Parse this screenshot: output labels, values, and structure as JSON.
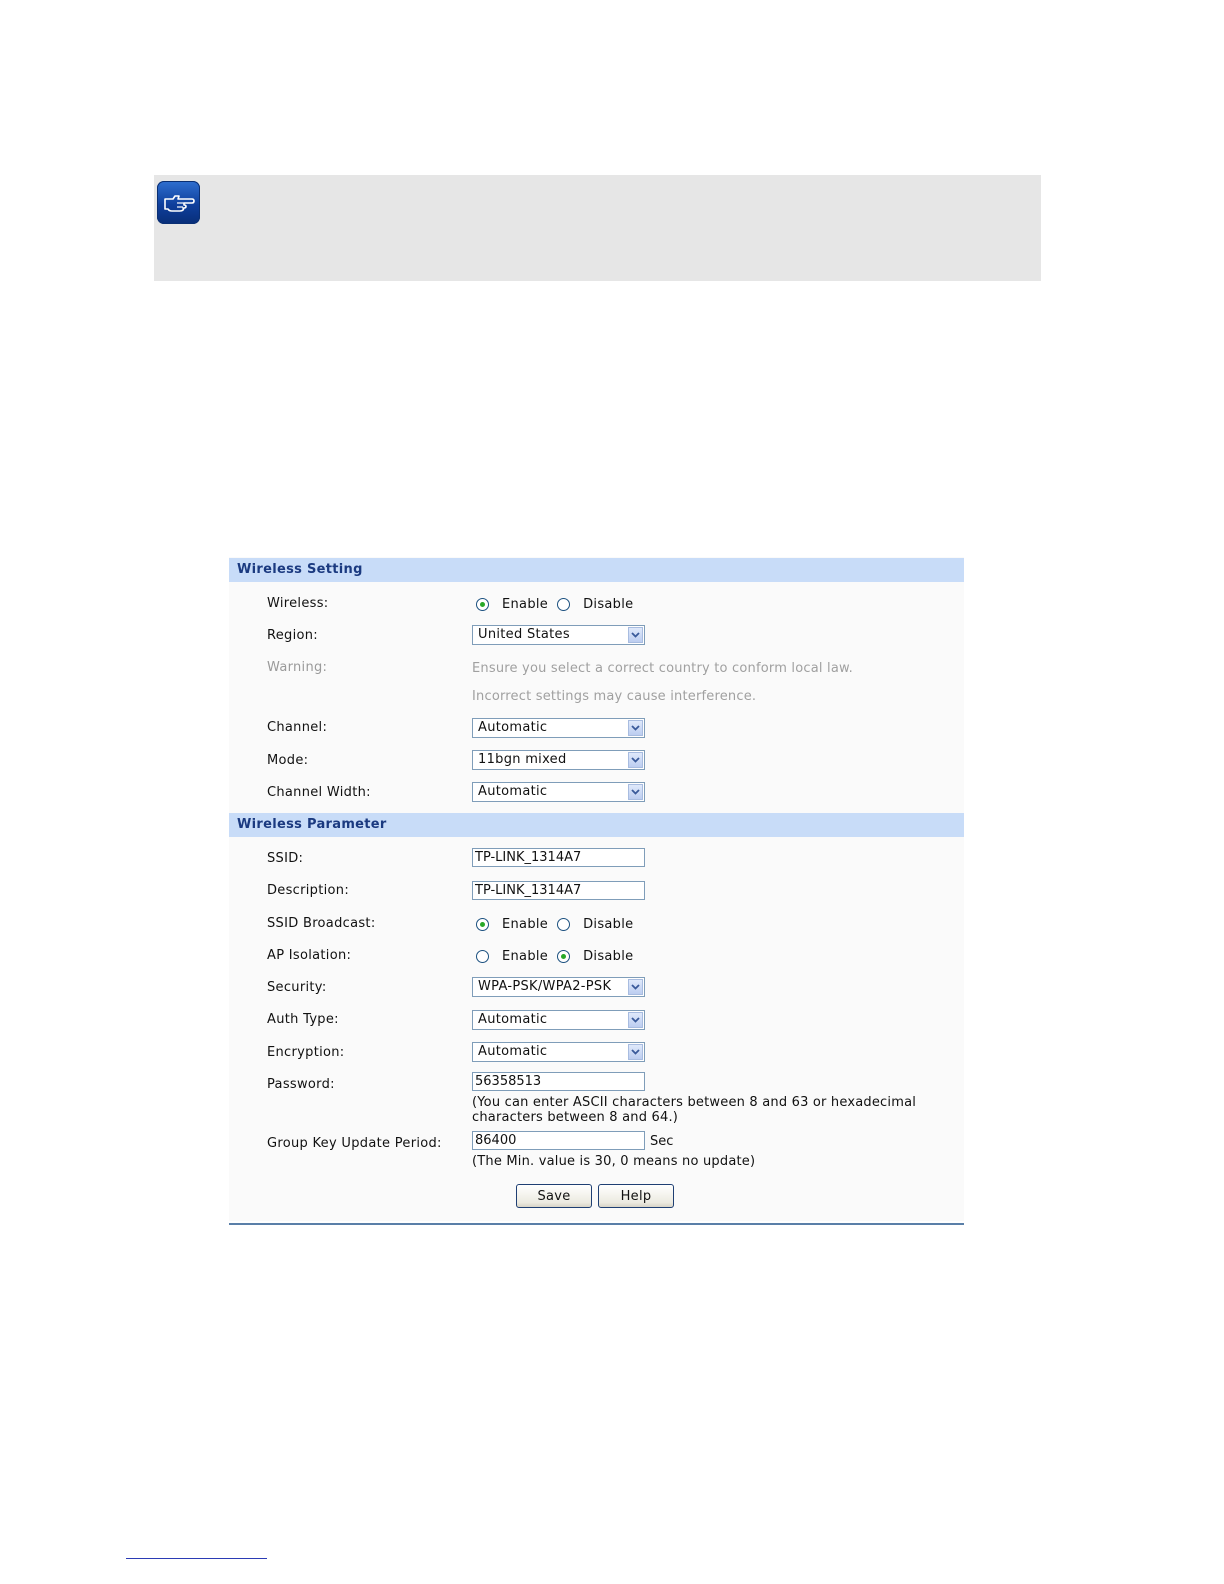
{
  "note": {
    "icon": "pointing-hand-icon",
    "icon_color": "#0f3f9c"
  },
  "wireless_setting": {
    "header": "Wireless Setting",
    "wireless": {
      "label": "Wireless:",
      "options": [
        "Enable",
        "Disable"
      ],
      "selected": "Enable"
    },
    "region": {
      "label": "Region:",
      "value": "United States"
    },
    "warning": {
      "label": "Warning:",
      "line1": "Ensure you select a correct country to conform local law.",
      "line2": "Incorrect settings may cause interference."
    },
    "channel": {
      "label": "Channel:",
      "value": "Automatic"
    },
    "mode": {
      "label": "Mode:",
      "value": "11bgn mixed"
    },
    "channel_width": {
      "label": "Channel Width:",
      "value": "Automatic"
    }
  },
  "wireless_parameter": {
    "header": "Wireless Parameter",
    "ssid": {
      "label": "SSID:",
      "value": "TP-LINK_1314A7"
    },
    "description": {
      "label": "Description:",
      "value": "TP-LINK_1314A7"
    },
    "ssid_broadcast": {
      "label": "SSID Broadcast:",
      "options": [
        "Enable",
        "Disable"
      ],
      "selected": "Enable"
    },
    "ap_isolation": {
      "label": "AP Isolation:",
      "options": [
        "Enable",
        "Disable"
      ],
      "selected": "Disable"
    },
    "security": {
      "label": "Security:",
      "value": "WPA-PSK/WPA2-PSK"
    },
    "auth_type": {
      "label": "Auth Type:",
      "value": "Automatic"
    },
    "encryption": {
      "label": "Encryption:",
      "value": "Automatic"
    },
    "password": {
      "label": "Password:",
      "value": "56358513",
      "hint_line1": "(You can enter ASCII characters between 8 and 63 or hexadecimal",
      "hint_line2": "characters between 8 and 64.)"
    },
    "group_key": {
      "label": "Group Key Update Period:",
      "value": "86400",
      "unit": "Sec",
      "hint": "(The Min. value is 30, 0 means no update)"
    }
  },
  "buttons": {
    "save": "Save",
    "help": "Help"
  },
  "colors": {
    "section_header_bg": "#c8dcf8",
    "section_header_text": "#1b3a80",
    "radio_checked": "#28a828"
  }
}
